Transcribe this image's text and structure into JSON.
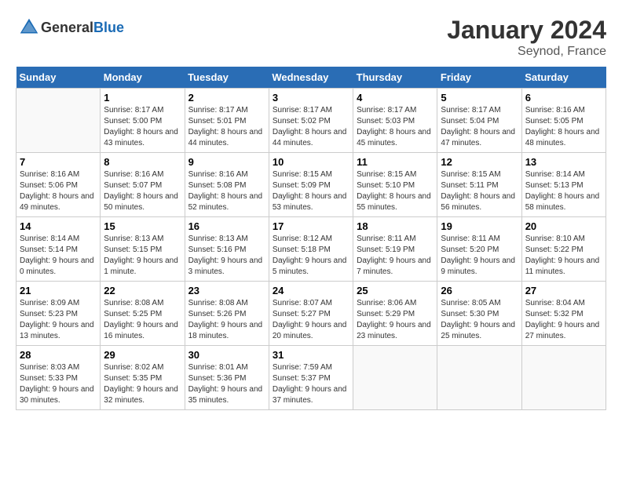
{
  "header": {
    "logo_general": "General",
    "logo_blue": "Blue",
    "month": "January 2024",
    "location": "Seynod, France"
  },
  "days_of_week": [
    "Sunday",
    "Monday",
    "Tuesday",
    "Wednesday",
    "Thursday",
    "Friday",
    "Saturday"
  ],
  "weeks": [
    [
      {
        "day": "",
        "empty": true
      },
      {
        "day": "1",
        "sunrise": "Sunrise: 8:17 AM",
        "sunset": "Sunset: 5:00 PM",
        "daylight": "Daylight: 8 hours and 43 minutes."
      },
      {
        "day": "2",
        "sunrise": "Sunrise: 8:17 AM",
        "sunset": "Sunset: 5:01 PM",
        "daylight": "Daylight: 8 hours and 44 minutes."
      },
      {
        "day": "3",
        "sunrise": "Sunrise: 8:17 AM",
        "sunset": "Sunset: 5:02 PM",
        "daylight": "Daylight: 8 hours and 44 minutes."
      },
      {
        "day": "4",
        "sunrise": "Sunrise: 8:17 AM",
        "sunset": "Sunset: 5:03 PM",
        "daylight": "Daylight: 8 hours and 45 minutes."
      },
      {
        "day": "5",
        "sunrise": "Sunrise: 8:17 AM",
        "sunset": "Sunset: 5:04 PM",
        "daylight": "Daylight: 8 hours and 47 minutes."
      },
      {
        "day": "6",
        "sunrise": "Sunrise: 8:16 AM",
        "sunset": "Sunset: 5:05 PM",
        "daylight": "Daylight: 8 hours and 48 minutes."
      }
    ],
    [
      {
        "day": "7",
        "sunrise": "Sunrise: 8:16 AM",
        "sunset": "Sunset: 5:06 PM",
        "daylight": "Daylight: 8 hours and 49 minutes."
      },
      {
        "day": "8",
        "sunrise": "Sunrise: 8:16 AM",
        "sunset": "Sunset: 5:07 PM",
        "daylight": "Daylight: 8 hours and 50 minutes."
      },
      {
        "day": "9",
        "sunrise": "Sunrise: 8:16 AM",
        "sunset": "Sunset: 5:08 PM",
        "daylight": "Daylight: 8 hours and 52 minutes."
      },
      {
        "day": "10",
        "sunrise": "Sunrise: 8:15 AM",
        "sunset": "Sunset: 5:09 PM",
        "daylight": "Daylight: 8 hours and 53 minutes."
      },
      {
        "day": "11",
        "sunrise": "Sunrise: 8:15 AM",
        "sunset": "Sunset: 5:10 PM",
        "daylight": "Daylight: 8 hours and 55 minutes."
      },
      {
        "day": "12",
        "sunrise": "Sunrise: 8:15 AM",
        "sunset": "Sunset: 5:11 PM",
        "daylight": "Daylight: 8 hours and 56 minutes."
      },
      {
        "day": "13",
        "sunrise": "Sunrise: 8:14 AM",
        "sunset": "Sunset: 5:13 PM",
        "daylight": "Daylight: 8 hours and 58 minutes."
      }
    ],
    [
      {
        "day": "14",
        "sunrise": "Sunrise: 8:14 AM",
        "sunset": "Sunset: 5:14 PM",
        "daylight": "Daylight: 9 hours and 0 minutes."
      },
      {
        "day": "15",
        "sunrise": "Sunrise: 8:13 AM",
        "sunset": "Sunset: 5:15 PM",
        "daylight": "Daylight: 9 hours and 1 minute."
      },
      {
        "day": "16",
        "sunrise": "Sunrise: 8:13 AM",
        "sunset": "Sunset: 5:16 PM",
        "daylight": "Daylight: 9 hours and 3 minutes."
      },
      {
        "day": "17",
        "sunrise": "Sunrise: 8:12 AM",
        "sunset": "Sunset: 5:18 PM",
        "daylight": "Daylight: 9 hours and 5 minutes."
      },
      {
        "day": "18",
        "sunrise": "Sunrise: 8:11 AM",
        "sunset": "Sunset: 5:19 PM",
        "daylight": "Daylight: 9 hours and 7 minutes."
      },
      {
        "day": "19",
        "sunrise": "Sunrise: 8:11 AM",
        "sunset": "Sunset: 5:20 PM",
        "daylight": "Daylight: 9 hours and 9 minutes."
      },
      {
        "day": "20",
        "sunrise": "Sunrise: 8:10 AM",
        "sunset": "Sunset: 5:22 PM",
        "daylight": "Daylight: 9 hours and 11 minutes."
      }
    ],
    [
      {
        "day": "21",
        "sunrise": "Sunrise: 8:09 AM",
        "sunset": "Sunset: 5:23 PM",
        "daylight": "Daylight: 9 hours and 13 minutes."
      },
      {
        "day": "22",
        "sunrise": "Sunrise: 8:08 AM",
        "sunset": "Sunset: 5:25 PM",
        "daylight": "Daylight: 9 hours and 16 minutes."
      },
      {
        "day": "23",
        "sunrise": "Sunrise: 8:08 AM",
        "sunset": "Sunset: 5:26 PM",
        "daylight": "Daylight: 9 hours and 18 minutes."
      },
      {
        "day": "24",
        "sunrise": "Sunrise: 8:07 AM",
        "sunset": "Sunset: 5:27 PM",
        "daylight": "Daylight: 9 hours and 20 minutes."
      },
      {
        "day": "25",
        "sunrise": "Sunrise: 8:06 AM",
        "sunset": "Sunset: 5:29 PM",
        "daylight": "Daylight: 9 hours and 23 minutes."
      },
      {
        "day": "26",
        "sunrise": "Sunrise: 8:05 AM",
        "sunset": "Sunset: 5:30 PM",
        "daylight": "Daylight: 9 hours and 25 minutes."
      },
      {
        "day": "27",
        "sunrise": "Sunrise: 8:04 AM",
        "sunset": "Sunset: 5:32 PM",
        "daylight": "Daylight: 9 hours and 27 minutes."
      }
    ],
    [
      {
        "day": "28",
        "sunrise": "Sunrise: 8:03 AM",
        "sunset": "Sunset: 5:33 PM",
        "daylight": "Daylight: 9 hours and 30 minutes."
      },
      {
        "day": "29",
        "sunrise": "Sunrise: 8:02 AM",
        "sunset": "Sunset: 5:35 PM",
        "daylight": "Daylight: 9 hours and 32 minutes."
      },
      {
        "day": "30",
        "sunrise": "Sunrise: 8:01 AM",
        "sunset": "Sunset: 5:36 PM",
        "daylight": "Daylight: 9 hours and 35 minutes."
      },
      {
        "day": "31",
        "sunrise": "Sunrise: 7:59 AM",
        "sunset": "Sunset: 5:37 PM",
        "daylight": "Daylight: 9 hours and 37 minutes."
      },
      {
        "day": "",
        "empty": true
      },
      {
        "day": "",
        "empty": true
      },
      {
        "day": "",
        "empty": true
      }
    ]
  ]
}
